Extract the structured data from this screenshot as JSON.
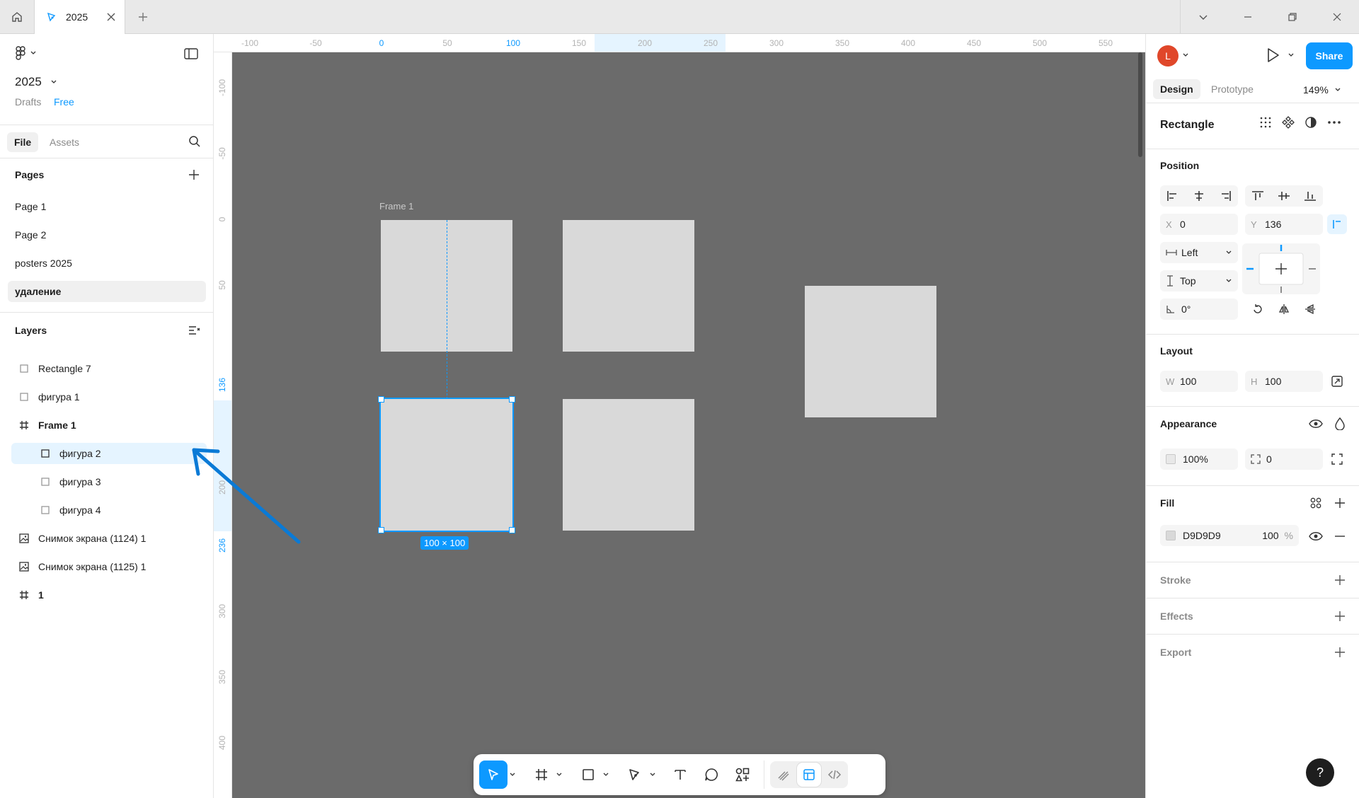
{
  "titlebar": {
    "tab_title": "2025"
  },
  "file": {
    "name": "2025",
    "location": "Drafts",
    "plan": "Free"
  },
  "left_tabs": {
    "file": "File",
    "assets": "Assets"
  },
  "pages": {
    "title": "Pages",
    "items": [
      {
        "label": "Page 1",
        "active": false
      },
      {
        "label": "Page 2",
        "active": false
      },
      {
        "label": "posters 2025",
        "active": false
      },
      {
        "label": "удаление",
        "active": true
      }
    ]
  },
  "layers": {
    "title": "Layers",
    "items": [
      {
        "label": "Rectangle 7",
        "icon": "rectangle-icon",
        "indent": 0,
        "bold": false,
        "selected": false
      },
      {
        "label": "фигура 1",
        "icon": "rectangle-icon",
        "indent": 0,
        "bold": false,
        "selected": false
      },
      {
        "label": "Frame 1",
        "icon": "frame-icon",
        "indent": 0,
        "bold": true,
        "selected": false
      },
      {
        "label": "фигура 2",
        "icon": "rectangle-icon",
        "indent": 1,
        "bold": false,
        "selected": true
      },
      {
        "label": "фигура 3",
        "icon": "rectangle-icon",
        "indent": 1,
        "bold": false,
        "selected": false
      },
      {
        "label": "фигура 4",
        "icon": "rectangle-icon",
        "indent": 1,
        "bold": false,
        "selected": false
      },
      {
        "label": "Снимок экрана (1124) 1",
        "icon": "image-icon",
        "indent": 0,
        "bold": false,
        "selected": false
      },
      {
        "label": "Снимок экрана (1125) 1",
        "icon": "image-icon",
        "indent": 0,
        "bold": false,
        "selected": false
      },
      {
        "label": "1",
        "icon": "frame-icon",
        "indent": 0,
        "bold": true,
        "selected": false
      }
    ]
  },
  "rulers": {
    "horizontal": [
      "-100",
      "-50",
      "0",
      "50",
      "100",
      "150",
      "200",
      "250",
      "300",
      "350",
      "400",
      "450",
      "500",
      "550"
    ],
    "vertical": [
      "-100",
      "-50",
      "0",
      "50",
      "136",
      "200",
      "236",
      "300",
      "350",
      "400"
    ]
  },
  "canvas": {
    "frame_label": "Frame 1",
    "selection_size": "100 × 100",
    "background": "#6b6b6b",
    "shape_fill": "#D9D9D9"
  },
  "right": {
    "avatar_initial": "L",
    "share": "Share",
    "tabs": {
      "design": "Design",
      "prototype": "Prototype"
    },
    "zoom": "149%",
    "object_type": "Rectangle",
    "position": {
      "title": "Position",
      "x_label": "X",
      "x": "0",
      "y_label": "Y",
      "y": "136",
      "h_constraint": "Left",
      "v_constraint": "Top",
      "rotation": "0°"
    },
    "layout": {
      "title": "Layout",
      "w_label": "W",
      "w": "100",
      "h_label": "H",
      "h": "100"
    },
    "appearance": {
      "title": "Appearance",
      "opacity": "100%",
      "radius": "0"
    },
    "fill": {
      "title": "Fill",
      "hex": "D9D9D9",
      "opacity": "100",
      "unit": "%"
    },
    "stroke": {
      "title": "Stroke"
    },
    "effects": {
      "title": "Effects"
    },
    "export": {
      "title": "Export"
    },
    "help": "?"
  },
  "colors": {
    "accent": "#0d99ff",
    "annotation_arrow": "#0a7ad6"
  }
}
